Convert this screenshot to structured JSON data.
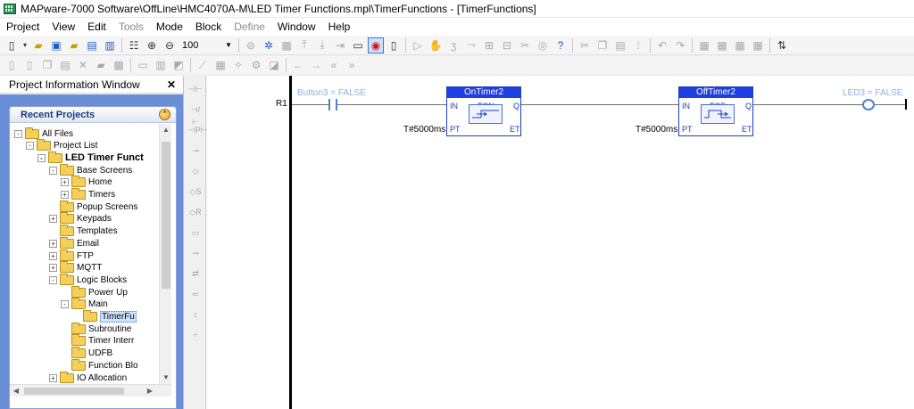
{
  "window": {
    "title": "MAPware-7000 Software\\OffLine\\HMC4070A-M\\LED Timer Functions.mpl\\TimerFunctions - [TimerFunctions]"
  },
  "menu": {
    "items": [
      {
        "label": "Project",
        "enabled": true
      },
      {
        "label": "View",
        "enabled": true
      },
      {
        "label": "Edit",
        "enabled": true
      },
      {
        "label": "Tools",
        "enabled": false
      },
      {
        "label": "Mode",
        "enabled": true
      },
      {
        "label": "Block",
        "enabled": true
      },
      {
        "label": "Define",
        "enabled": false
      },
      {
        "label": "Window",
        "enabled": true
      },
      {
        "label": "Help",
        "enabled": true
      }
    ]
  },
  "toolbar": {
    "zoom_value": "100",
    "icons_row1": [
      "new-file-icon",
      "open-folder-icon",
      "save-icon",
      "open-project-icon",
      "download-icon",
      "upload-icon",
      "properties-icon",
      "zoom-in-icon",
      "zoom-out-icon"
    ],
    "icons_row1b": [
      "compile-icon",
      "settings-icon",
      "image-icon",
      "export-icon",
      "import-icon",
      "transfer-icon",
      "screen-icon",
      "record-icon",
      "page-icon"
    ],
    "icons_row1c": [
      "pointer-icon",
      "hand-icon",
      "tool-a-icon",
      "tool-b-icon",
      "tool-c-icon",
      "tool-d-icon",
      "tool-e-icon",
      "tool-f-icon",
      "help-icon"
    ],
    "icons_row1d": [
      "cut-icon",
      "copy-icon",
      "paste-icon",
      "select-icon",
      "undo-icon",
      "redo-icon",
      "grid-a-icon",
      "grid-b-icon",
      "grid-c-icon",
      "grid-d-icon",
      "sort-icon"
    ]
  },
  "left_pane": {
    "title": "Project Information Window",
    "recent_title": "Recent Projects",
    "tree": [
      {
        "label": "All Files",
        "level": 0,
        "expander": "-"
      },
      {
        "label": "Project List",
        "level": 1,
        "expander": "-"
      },
      {
        "label": "LED Timer Funct",
        "level": 2,
        "expander": "-",
        "bold": true
      },
      {
        "label": "Base Screens",
        "level": 3,
        "expander": "-"
      },
      {
        "label": "Home",
        "level": 4,
        "expander": "+"
      },
      {
        "label": "Timers",
        "level": 4,
        "expander": "+"
      },
      {
        "label": "Popup Screens",
        "level": 3,
        "expander": ""
      },
      {
        "label": "Keypads",
        "level": 3,
        "expander": "+"
      },
      {
        "label": "Templates",
        "level": 3,
        "expander": ""
      },
      {
        "label": "Email",
        "level": 3,
        "expander": "+"
      },
      {
        "label": "FTP",
        "level": 3,
        "expander": "+"
      },
      {
        "label": "MQTT",
        "level": 3,
        "expander": "+"
      },
      {
        "label": "Logic Blocks",
        "level": 3,
        "expander": "-"
      },
      {
        "label": "Power Up",
        "level": 4,
        "expander": ""
      },
      {
        "label": "Main",
        "level": 4,
        "expander": "-"
      },
      {
        "label": "TimerFu",
        "level": 5,
        "expander": "",
        "selected": true
      },
      {
        "label": "Subroutine",
        "level": 4,
        "expander": ""
      },
      {
        "label": "Timer Interr",
        "level": 4,
        "expander": ""
      },
      {
        "label": "UDFB",
        "level": 4,
        "expander": ""
      },
      {
        "label": "Function Blo",
        "level": 4,
        "expander": ""
      },
      {
        "label": "IO Allocation",
        "level": 3,
        "expander": "+"
      }
    ]
  },
  "ladder": {
    "rung_label": "R1",
    "contact_label": "Button3 = FALSE",
    "coil_label": "LED3 = FALSE",
    "blocks": [
      {
        "name": "OnTimer2",
        "type": "TON",
        "in": "IN",
        "q": "Q",
        "pt": "PT",
        "et": "ET",
        "pt_value": "T#5000ms"
      },
      {
        "name": "OffTimer2",
        "type": "TOF",
        "in": "IN",
        "q": "Q",
        "pt": "PT",
        "et": "ET",
        "pt_value": "T#5000ms"
      }
    ]
  },
  "colors": {
    "block_header": "#1f3fe0",
    "block_border": "#1c3fbf",
    "contact": "#4a86c7",
    "label_blue": "#8fb3d9",
    "pane_background": "#6b8fd6"
  }
}
